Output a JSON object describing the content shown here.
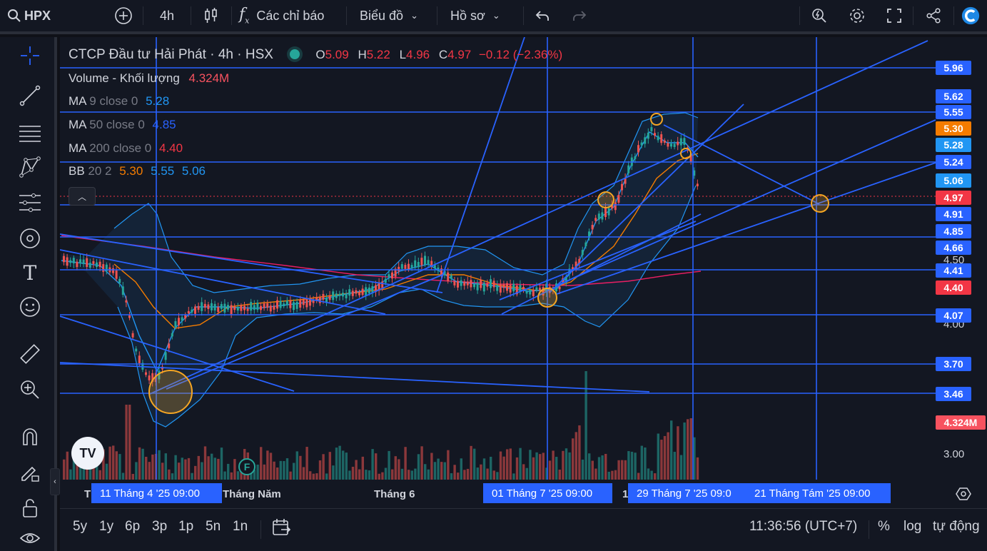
{
  "topbar": {
    "symbol": "HPX",
    "interval": "4h",
    "indicators_label": "Các chỉ báo",
    "chart_type_label": "Biểu đồ",
    "profile_label": "Hồ sơ"
  },
  "legend": {
    "title": "CTCP Đầu tư Hải Phát · 4h · HSX",
    "o_label": "O",
    "o_value": "5.09",
    "h_label": "H",
    "h_value": "5.22",
    "l_label": "L",
    "l_value": "4.96",
    "c_label": "C",
    "c_value": "4.97",
    "change": "−0.12 (−2.36%)",
    "volume_label": "Volume - Khối lượng",
    "volume_value": "4.324M",
    "ma9_label": "MA",
    "ma9_params": "9 close 0",
    "ma9_value": "5.28",
    "ma50_label": "MA",
    "ma50_params": "50 close 0",
    "ma50_value": "4.85",
    "ma200_label": "MA",
    "ma200_params": "200 close 0",
    "ma200_value": "4.40",
    "bb_label": "BB",
    "bb_params": "20 2",
    "bb_v1": "5.30",
    "bb_v2": "5.55",
    "bb_v3": "5.06"
  },
  "price_labels": [
    {
      "text": "5.96",
      "color": "#2962ff"
    },
    {
      "text": "5.62",
      "color": "#2962ff"
    },
    {
      "text": "5.55",
      "color": "#2962ff"
    },
    {
      "text": "5.30",
      "color": "#f57c00"
    },
    {
      "text": "5.28",
      "color": "#2196f3"
    },
    {
      "text": "5.24",
      "color": "#2962ff"
    },
    {
      "text": "5.06",
      "color": "#2196f3"
    },
    {
      "text": "4.97",
      "color": "#f23645"
    },
    {
      "text": "4.91",
      "color": "#2962ff"
    },
    {
      "text": "4.85",
      "color": "#2962ff"
    },
    {
      "text": "4.66",
      "color": "#2962ff"
    },
    {
      "text": "4.41",
      "color": "#2962ff"
    },
    {
      "text": "4.40",
      "color": "#f23645"
    },
    {
      "text": "4.07",
      "color": "#2962ff"
    },
    {
      "text": "3.70",
      "color": "#2962ff"
    },
    {
      "text": "3.46",
      "color": "#2962ff"
    },
    {
      "text": "4.324M",
      "color": "#f7525f"
    }
  ],
  "axis_prices": {
    "p450": "4.50",
    "p400": "4.00",
    "p300": "3.00"
  },
  "time_axis": {
    "t_prefix": "T",
    "month5": "Tháng Năm",
    "month6": "Tháng 6",
    "t_mid": "1",
    "label1": "11 Tháng 4 '25   09:00",
    "label2": "01 Tháng 7 '25   09:00",
    "label3": "29 Tháng 7 '25   09:0",
    "label4": "21 Tháng Tám '25   09:00"
  },
  "bottombar": {
    "ranges": [
      "5y",
      "1y",
      "6p",
      "3p",
      "1p",
      "5n",
      "1n"
    ],
    "clock": "11:36:56 (UTC+7)",
    "percent": "%",
    "log": "log",
    "auto": "tự động"
  },
  "chart_meta": {
    "logo_text": "TV",
    "event_badge": "F",
    "colors": {
      "up": "#26a69a",
      "down": "#ef5350",
      "drawing": "#2962ff",
      "ma9": "#2196f3",
      "ma50": "#f57c00",
      "ma200": "#e91e63",
      "highlight": "#f5a623"
    }
  }
}
